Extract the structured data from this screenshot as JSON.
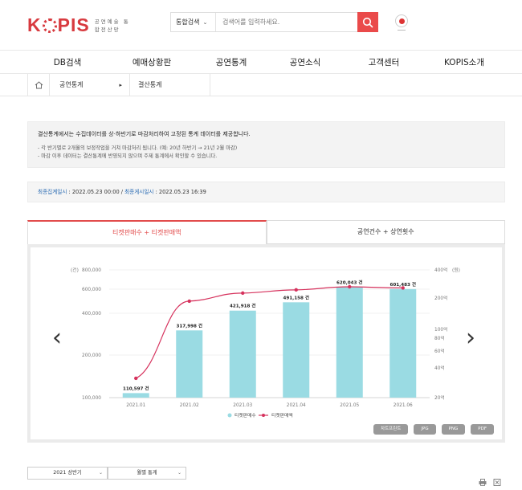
{
  "header": {
    "logo_text_pre": "K",
    "logo_text_post": "PIS",
    "logo_sub": "공연예술 통합전산망",
    "search_select": "통합검색",
    "search_placeholder": "검색어를 입력하세요.",
    "brand_color": "#d83a3f",
    "accent_color": "#ea4a4a"
  },
  "gnb": [
    "DB검색",
    "예매상황판",
    "공연통계",
    "공연소식",
    "고객센터",
    "KOPIS소개"
  ],
  "breadcrumb": {
    "level1": "공연통계",
    "level2": "결산통계"
  },
  "notice": {
    "title": "결산통계에서는 수집데이터를 상·하반기로 마감처리하여 고정된 통계 데이터를 제공합니다.",
    "items": [
      "- 각 반기별로 2개월의 보정작업을 거쳐 마감처리 됩니다. (예: 20년 하반기 → 21년 2월 마감)",
      "- 마감 이후 데이터는 결산통계에 반영되지 않으며 주제 통계에서 확인할 수 있습니다."
    ]
  },
  "aggregation": {
    "label1": "최종집계일시",
    "value1": " : 2022.05.23 00:00 / ",
    "label2": "최종게시일시",
    "value2": " : 2022.05.23 16:39"
  },
  "tabs": [
    "티켓판매수 + 티켓판매액",
    "공연건수 + 상연횟수"
  ],
  "chart_data": {
    "type": "bar",
    "categories": [
      "2021.01",
      "2021.02",
      "2021.03",
      "2021.04",
      "2021.05",
      "2021.06"
    ],
    "series": [
      {
        "name": "티켓판매수",
        "type": "bar",
        "values": [
          110597,
          317998,
          421918,
          491158,
          620043,
          601483
        ],
        "labels": [
          "110,597 건",
          "317,998 건",
          "421,918 건",
          "491,158 건",
          "620,043 건",
          "601,483 건"
        ],
        "color": "#9adbe3"
      },
      {
        "name": "티켓판매액",
        "type": "line",
        "values": [
          33,
          190,
          235,
          258,
          280,
          272
        ],
        "color": "#d6325d"
      }
    ],
    "y_left": {
      "unit": "(건)",
      "ticks": [
        "800,000",
        "600,000",
        "400,000",
        "200,000",
        "100,000"
      ]
    },
    "y_right": {
      "unit": "(원)",
      "ticks": [
        "400억",
        "200억",
        "100억",
        "80억",
        "60억",
        "40억",
        "20억"
      ]
    },
    "legend": "bottom-center"
  },
  "downloads": [
    "차트프린트",
    "JPG",
    "PNG",
    "PDF"
  ],
  "filters": {
    "period": "2021 상반기",
    "type": "월별 통계"
  }
}
